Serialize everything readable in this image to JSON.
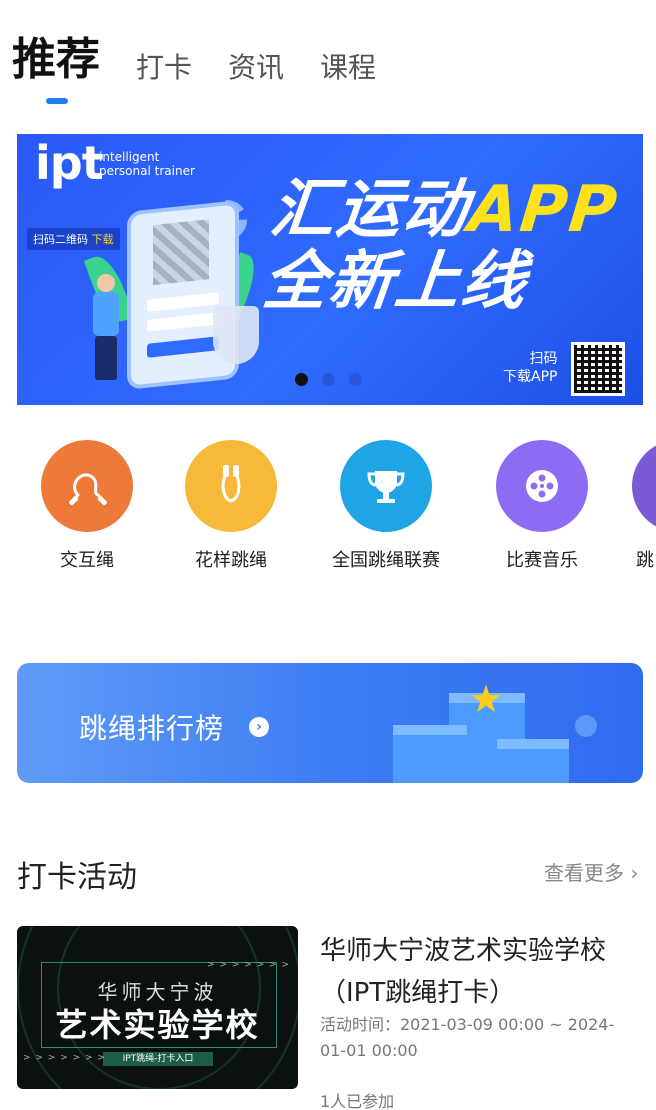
{
  "tabs": [
    {
      "label": "推荐",
      "active": true
    },
    {
      "label": "打卡"
    },
    {
      "label": "资讯"
    },
    {
      "label": "课程"
    }
  ],
  "banner": {
    "logo": "ipt",
    "logo_sub_1": "intelligent",
    "logo_sub_2": "personal trainer",
    "scan_tag": "扫码二维码",
    "scan_tag_hl": "下载",
    "headline_1": "汇运动",
    "headline_app": "APP",
    "headline_2": "全新上线",
    "scan_text_1": "扫码",
    "scan_text_2": "下载APP",
    "page_count": 3,
    "current_page": 1
  },
  "quick_entries": [
    {
      "label": "交互绳",
      "color": "#ee7a3a",
      "icon": "jump-rope-icon"
    },
    {
      "label": "花样跳绳",
      "color": "#f6b93a",
      "icon": "jump-rope-handles-icon"
    },
    {
      "label": "全国跳绳联赛",
      "color": "#1fa4e6",
      "icon": "trophy-icon"
    },
    {
      "label": "比赛音乐",
      "color": "#8b6cf2",
      "icon": "film-reel-icon"
    },
    {
      "label": "跳",
      "color": "#7c5ad6",
      "icon": "partial-entry-icon"
    }
  ],
  "rank_banner": {
    "label": "跳绳排行榜",
    "arrow": "›"
  },
  "section": {
    "title": "打卡活动",
    "more": "查看更多 ›"
  },
  "activity": {
    "thumb_line1": "华师大宁波",
    "thumb_line2": "艺术实验学校",
    "thumb_line3": "IPT跳绳-打卡入口",
    "thumb_arrows": "> > > > > > >",
    "title": "华师大宁波艺术实验学校（IPT跳绳打卡）",
    "time": "活动时间：2021-03-09 00:00 ~ 2024-01-01 00:00",
    "joined": "1人已参加"
  }
}
